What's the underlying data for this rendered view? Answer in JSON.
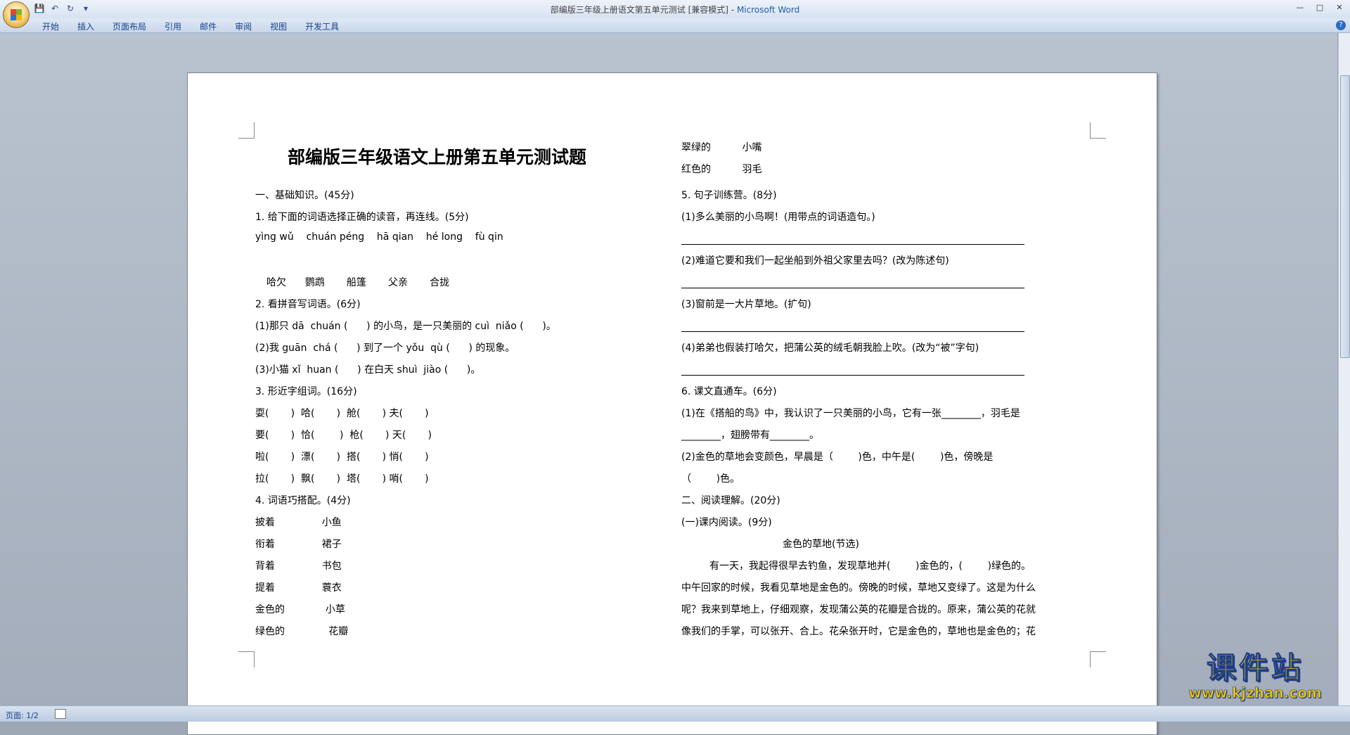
{
  "window": {
    "title": "部编版三年级上册语文第五单元测试 [兼容模式]",
    "app_name": "Microsoft Word",
    "separator": " - ",
    "quick_access": [
      "save-icon",
      "undo-icon",
      "redo-icon",
      "customize-icon"
    ],
    "controls": [
      "minimize-icon",
      "maximize-icon",
      "close-icon"
    ]
  },
  "ribbon": {
    "tabs": [
      "开始",
      "插入",
      "页面布局",
      "引用",
      "邮件",
      "审阅",
      "视图",
      "开发工具"
    ],
    "help": "?"
  },
  "status": {
    "page": "页面: 1/2"
  },
  "watermark": {
    "text": "课件站",
    "url": "www.kjzhan.com"
  },
  "doc": {
    "title": "部编版三年级语文上册第五单元测试题",
    "left": [
      "一、基础知识。(45分)",
      "1. 给下面的词语选择正确的读音，再连线。(5分)",
      "yìng wǔ    chuán péng    hā qian    hé long    fù qin",
      "",
      "哈欠      鹦鹉       船篷       父亲       合拢",
      "2. 看拼音写词语。(6分)",
      "(1)那只 dā  chuán (      ) 的小鸟，是一只美丽的 cuì  niǎo (      )。",
      "(2)我 guān  chá (      ) 到了一个 yǒu  qù (      ) 的现象。",
      "(3)小猫 xǐ  huan (      ) 在白天 shuì  jiào (      )。",
      "3. 形近字组词。(16分)",
      "耍(       )  哈(       )  舱(       ) 夫(       )",
      "要(       )  恰(        )  枪(       ) 天(       )",
      "啦(       )  漂(       )  搭(       ) 悄(       )",
      "拉(       )  飘(       )  塔(       ) 哨(       )",
      "4. 词语巧搭配。(4分)",
      "披着               小鱼",
      "衔着               裙子",
      "背着               书包",
      "提着               蓑衣",
      "金色的             小草",
      "绿色的              花瓣"
    ],
    "right": [
      "翠绿的          小嘴",
      "红色的          羽毛",
      "5. 句子训练营。(8分)",
      "(1)多么美丽的小鸟啊！(用带点的词语造句。)",
      "",
      "(2)难道它要和我们一起坐船到外祖父家里去吗？(改为陈述句)",
      "",
      "(3)窗前是一大片草地。(扩句)",
      "",
      "(4)弟弟也假装打哈欠，把蒲公英的绒毛朝我脸上吹。(改为“被”字句)",
      "",
      "6. 课文直通车。(6分)",
      "(1)在《搭船的鸟》中，我认识了一只美丽的小鸟，它有一张________，羽毛是",
      "________，翅膀带有________。",
      "(2)金色的草地会变颜色，早晨是（        )色，中午是(        )色，傍晚是",
      "（        )色。",
      "二、阅读理解。(20分)",
      "(一)课内阅读。(9分)",
      "金色的草地(节选)",
      "有一天，我起得很早去钓鱼，发现草地并(        )金色的，(        )绿色的。",
      "中午回家的时候，我看见草地是金色的。傍晚的时候，草地又变绿了。这是为什么",
      "呢？我来到草地上，仔细观察，发现蒲公英的花瓣是合拢的。原来，蒲公英的花就",
      "像我们的手掌，可以张开、合上。花朵张开时，它是金色的，草地也是金色的；花"
    ]
  }
}
